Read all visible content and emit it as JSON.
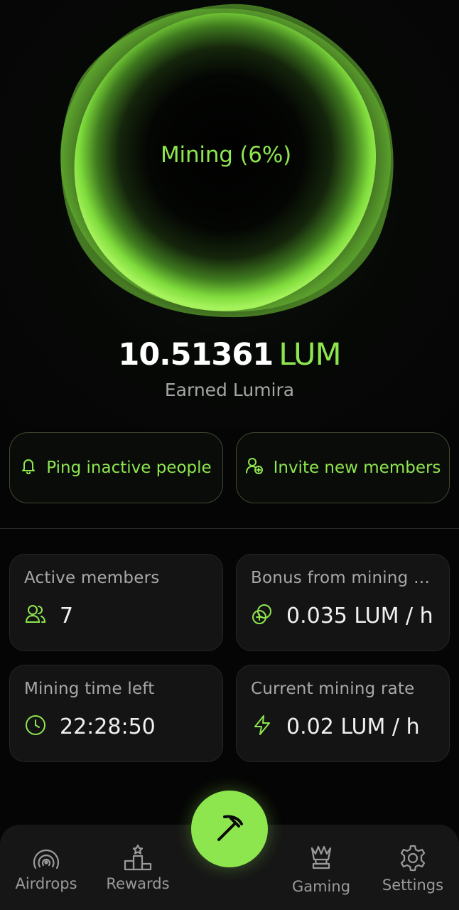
{
  "orb": {
    "label": "Mining (6%)",
    "progress_percent": 6
  },
  "balance": {
    "amount": "10.51361",
    "unit": "LUM",
    "caption": "Earned Lumira"
  },
  "actions": {
    "ping_label": "Ping inactive people",
    "invite_label": "Invite new members"
  },
  "stats": {
    "active_members": {
      "title": "Active members",
      "value": "7",
      "icon": "users-icon"
    },
    "bonus": {
      "title": "Bonus from mining t...",
      "value": "0.035 LUM / h",
      "icon": "coins-icon"
    },
    "time_left": {
      "title": "Mining time left",
      "value": "22:28:50",
      "icon": "clock-icon"
    },
    "rate": {
      "title": "Current mining rate",
      "value": "0.02 LUM / h",
      "icon": "lightning-icon"
    }
  },
  "nav": {
    "items": [
      {
        "label": "Airdrops",
        "icon": "broadcast-icon"
      },
      {
        "label": "Rewards",
        "icon": "podium-icon"
      },
      {
        "label": "Gaming",
        "icon": "chess-queen-icon"
      },
      {
        "label": "Settings",
        "icon": "gear-icon"
      }
    ],
    "center_icon": "pickaxe-icon"
  },
  "colors": {
    "accent": "#8ee64f",
    "background": "#050505",
    "card": "#141414",
    "nav": "#161616"
  }
}
